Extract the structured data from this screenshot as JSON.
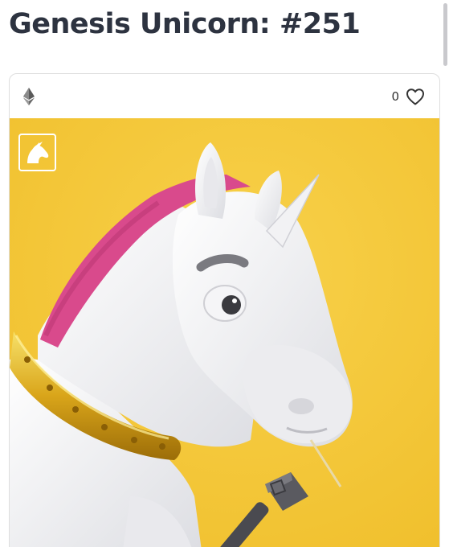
{
  "page": {
    "title": "Genesis Unicorn: #251"
  },
  "card": {
    "currency_icon": "ethereum-icon",
    "like_count": "0",
    "like_icon": "heart-outline-icon",
    "badge_icon": "unicorn-head-icon",
    "image_background": "#f5c93c"
  },
  "colors": {
    "title": "#2d3340",
    "accent_yellow": "#f5c93c",
    "mane_pink": "#d94a8c",
    "collar_gold": "#d9a51a"
  }
}
